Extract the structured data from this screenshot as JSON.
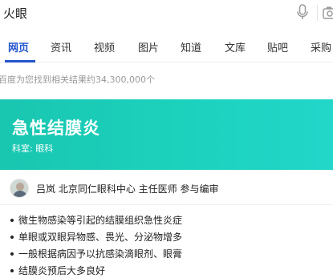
{
  "search": {
    "query": "火眼"
  },
  "tabs": [
    {
      "label": "网页",
      "active": true
    },
    {
      "label": "资讯",
      "active": false
    },
    {
      "label": "视频",
      "active": false
    },
    {
      "label": "图片",
      "active": false
    },
    {
      "label": "知道",
      "active": false
    },
    {
      "label": "文库",
      "active": false
    },
    {
      "label": "贴吧",
      "active": false
    },
    {
      "label": "采购",
      "active": false
    }
  ],
  "result_count": "百度为您找到相关结果约34,300,000个",
  "card": {
    "title": "急性结膜炎",
    "department": "科室: 眼科",
    "author_line": "吕岚  北京同仁眼科中心 主任医师 参与编审",
    "bullets": [
      "微生物感染等引起的结膜组织急性炎症",
      "单眼或双眼异物感、畏光、分泌物增多",
      "一般根据病因予以抗感染滴眼剂、眼膏",
      "结膜炎预后大多良好"
    ]
  },
  "colors": {
    "accent": "#2254cc",
    "banner": "#1ccfba"
  },
  "icons": [
    "microphone-icon",
    "camera-icon"
  ]
}
